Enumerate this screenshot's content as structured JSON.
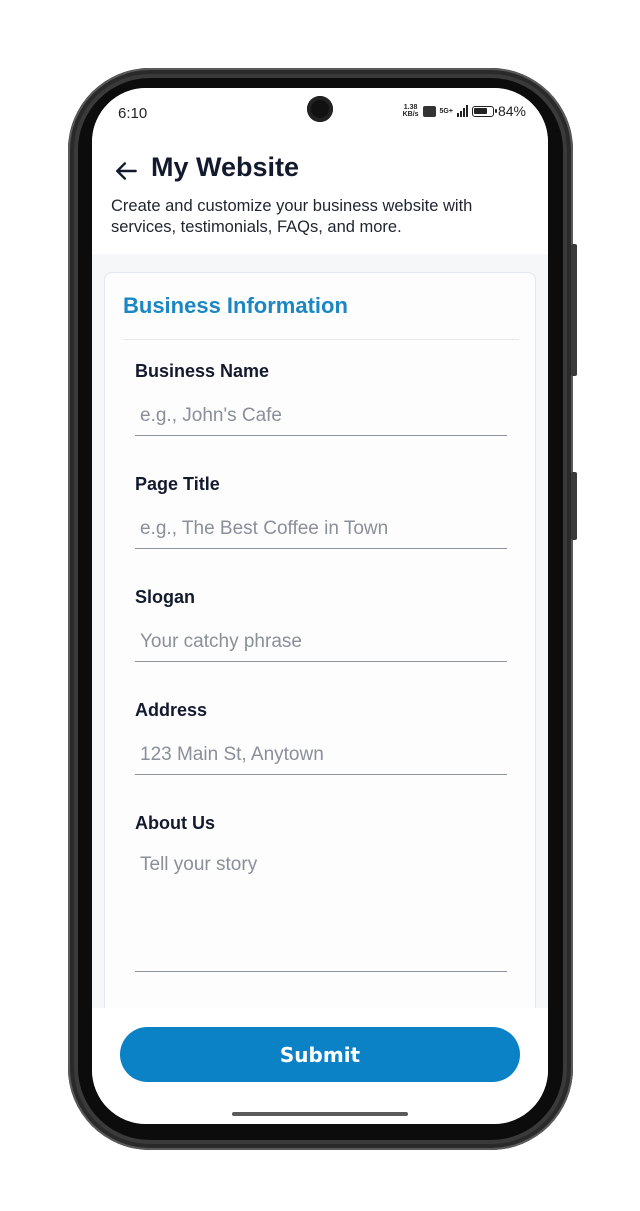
{
  "status_bar": {
    "time": "6:10",
    "net_speed_value": "1.38",
    "net_speed_unit": "KB/s",
    "network_type": "5G+",
    "battery_percent": "84%",
    "battery_level": 0.84
  },
  "header": {
    "back_icon": "arrow-left-icon",
    "title": "My Website",
    "description": "Create and customize your business website with services, testimonials, FAQs, and more."
  },
  "card": {
    "title": "Business Information",
    "fields": [
      {
        "label": "Business Name",
        "placeholder": "e.g., John's Cafe",
        "value": ""
      },
      {
        "label": "Page Title",
        "placeholder": "e.g., The Best Coffee in Town",
        "value": ""
      },
      {
        "label": "Slogan",
        "placeholder": "Your catchy phrase",
        "value": ""
      },
      {
        "label": "Address",
        "placeholder": "123 Main St, Anytown",
        "value": ""
      },
      {
        "label": "About Us",
        "placeholder": "Tell your story",
        "value": ""
      }
    ]
  },
  "footer": {
    "submit_label": "Submit"
  },
  "colors": {
    "accent": "#0b82c6",
    "section_title": "#1b87c2",
    "text_dark": "#141a2e"
  }
}
